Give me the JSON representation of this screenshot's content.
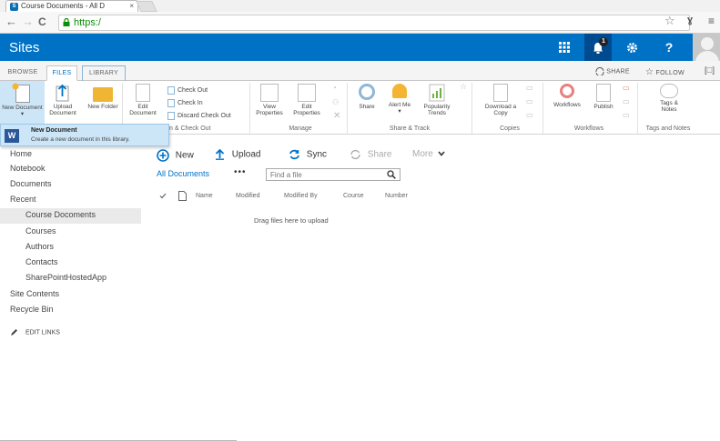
{
  "browser": {
    "tab_title": "Course Documents - All D",
    "tab_close": "×",
    "url": "https:/",
    "back": "←",
    "forward": "→",
    "reload": "C",
    "star": "☆",
    "menu": "≡"
  },
  "suitebar": {
    "brand": "Sites",
    "notification_count": "1",
    "help": "?"
  },
  "ribbon_tabs": [
    "BROWSE",
    "FILES",
    "LIBRARY"
  ],
  "ribbon_right": {
    "share": "SHARE",
    "follow": "FOLLOW"
  },
  "ribbon": {
    "new_document": "New Document",
    "upload_document": "Upload Document",
    "new_folder": "New Folder",
    "edit_document": "Edit Document",
    "check_out": "Check Out",
    "check_in": "Check In",
    "discard_check_out": "Discard Check Out",
    "group_open_check_out": "n & Check Out",
    "view_properties": "View Properties",
    "edit_properties": "Edit Properties",
    "group_manage": "Manage",
    "share": "Share",
    "alert_me": "Alert Me",
    "popularity_trends": "Popularity Trends",
    "group_share_track": "Share & Track",
    "download_copy": "Download a Copy",
    "group_copies": "Copies",
    "workflows": "Workflows",
    "publish": "Publish",
    "group_workflows": "Workflows",
    "tags_notes": "Tags & Notes",
    "group_tags_notes": "Tags and Notes"
  },
  "dropdown": {
    "title": "New Document",
    "description": "Create a new document in this library."
  },
  "leftnav": {
    "home": "Home",
    "notebook": "Notebook",
    "documents": "Documents",
    "recent": "Recent",
    "recent_items": [
      "Course Docoments",
      "Courses",
      "Authors",
      "Contacts",
      "SharePointHostedApp"
    ],
    "site_contents": "Site Contents",
    "recycle_bin": "Recycle Bin",
    "edit_links": "EDIT LINKS"
  },
  "commands": {
    "new": "New",
    "upload": "Upload",
    "sync": "Sync",
    "share": "Share",
    "more": "More"
  },
  "view": {
    "name": "All Documents",
    "ellipsis": "•••",
    "search_placeholder": "Find a file"
  },
  "columns": [
    "Name",
    "Modified",
    "Modified By",
    "Course",
    "Number"
  ],
  "empty_message": "Drag files here to upload",
  "colors": {
    "suitebar": "#0072c6",
    "accent": "#0072c6",
    "dropdown_bg": "#cde6f7"
  }
}
